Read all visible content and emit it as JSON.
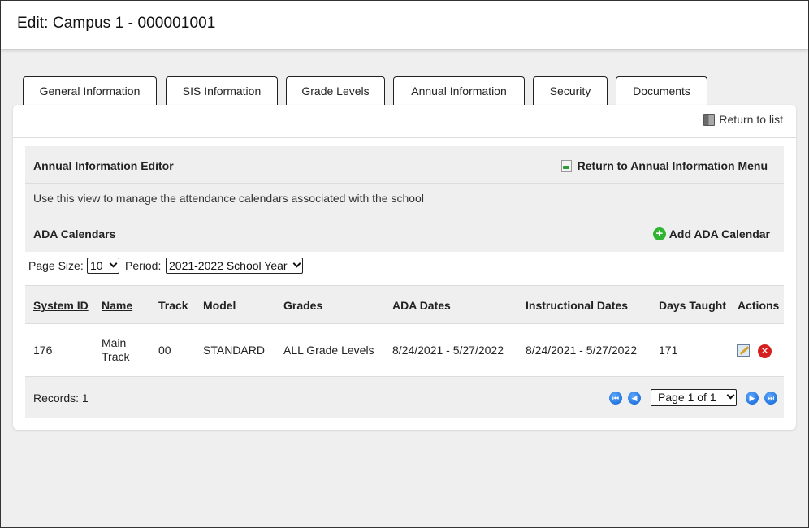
{
  "header": {
    "title": "Edit: Campus 1 - 000001001"
  },
  "tabs": [
    {
      "label": "General Information"
    },
    {
      "label": "SIS Information"
    },
    {
      "label": "Grade Levels"
    },
    {
      "label": "Annual Information"
    },
    {
      "label": "Security"
    },
    {
      "label": "Documents"
    }
  ],
  "toolbar": {
    "return_to_list": "Return to list"
  },
  "editor": {
    "title": "Annual Information Editor",
    "return_menu": "Return to Annual Information Menu",
    "description": "Use this view to manage the attendance calendars associated with the school"
  },
  "ada": {
    "title": "ADA Calendars",
    "add_label": "Add ADA Calendar"
  },
  "filters": {
    "page_size_label": "Page Size:",
    "page_size_value": "10",
    "period_label": "Period:",
    "period_value": "2021-2022 School Year"
  },
  "table": {
    "columns": [
      "System ID",
      "Name",
      "Track",
      "Model",
      "Grades",
      "ADA Dates",
      "Instructional Dates",
      "Days Taught",
      "Actions"
    ],
    "rows": [
      {
        "system_id": "176",
        "name_line1": "Main",
        "name_line2": "Track",
        "track": "00",
        "model": "STANDARD",
        "grades": "ALL Grade Levels",
        "ada_dates": "8/24/2021 - 5/27/2022",
        "instructional_dates": "8/24/2021 - 5/27/2022",
        "days_taught": "171"
      }
    ]
  },
  "footer": {
    "records": "Records: 1",
    "page_value": "Page 1 of 1"
  },
  "icons": {
    "return_list": "door-icon",
    "return_menu": "document-arrow-icon",
    "add": "plus-circle-icon",
    "edit": "edit-icon",
    "delete": "delete-icon",
    "first": "first-page-icon",
    "prev": "prev-page-icon",
    "next": "next-page-icon",
    "last": "last-page-icon"
  },
  "colors": {
    "add_green": "#2fb52f",
    "delete_red": "#d62020",
    "pager_blue": "#0b5fd0"
  }
}
